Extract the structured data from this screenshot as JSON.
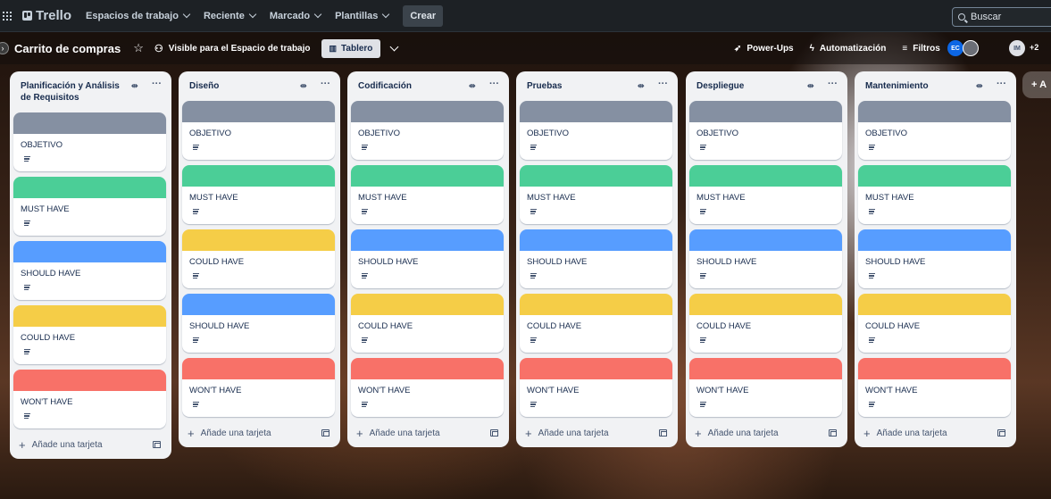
{
  "topnav": {
    "logo": "Trello",
    "items": [
      "Espacios de trabajo",
      "Reciente",
      "Marcado",
      "Plantillas"
    ],
    "create": "Crear",
    "search_placeholder": "Buscar"
  },
  "board": {
    "title": "Carrito de compras",
    "visibility": "Visible para el Espacio de trabajo",
    "view": "Tablero",
    "powerups": "Power-Ups",
    "automation": "Automatización",
    "filters": "Filtros",
    "members": [
      "EC",
      "IM"
    ],
    "extra_members": "+2",
    "add_list": "+ A"
  },
  "labels": {
    "objetivo": "OBJETIVO",
    "must": "MUST HAVE",
    "should": "SHOULD HAVE",
    "could": "COULD HAVE",
    "wont": "WON'T HAVE"
  },
  "colors": {
    "objetivo": "#8590a2",
    "must": "#4bce97",
    "should": "#579dff",
    "could": "#f5cd47",
    "wont": "#f87168"
  },
  "add_card": "Añade una tarjeta",
  "lists": [
    {
      "title": "Planificación y Análisis de Requisitos",
      "cards": [
        "objetivo",
        "must",
        "should",
        "could",
        "wont"
      ]
    },
    {
      "title": "Diseño",
      "cards": [
        "objetivo",
        "must",
        "could",
        "should",
        "wont"
      ]
    },
    {
      "title": "Codificación",
      "cards": [
        "objetivo",
        "must",
        "should",
        "could",
        "wont"
      ]
    },
    {
      "title": "Pruebas",
      "cards": [
        "objetivo",
        "must",
        "should",
        "could",
        "wont"
      ]
    },
    {
      "title": "Despliegue",
      "cards": [
        "objetivo",
        "must",
        "should",
        "could",
        "wont"
      ]
    },
    {
      "title": "Mantenimiento",
      "cards": [
        "objetivo",
        "must",
        "should",
        "could",
        "wont"
      ]
    }
  ]
}
